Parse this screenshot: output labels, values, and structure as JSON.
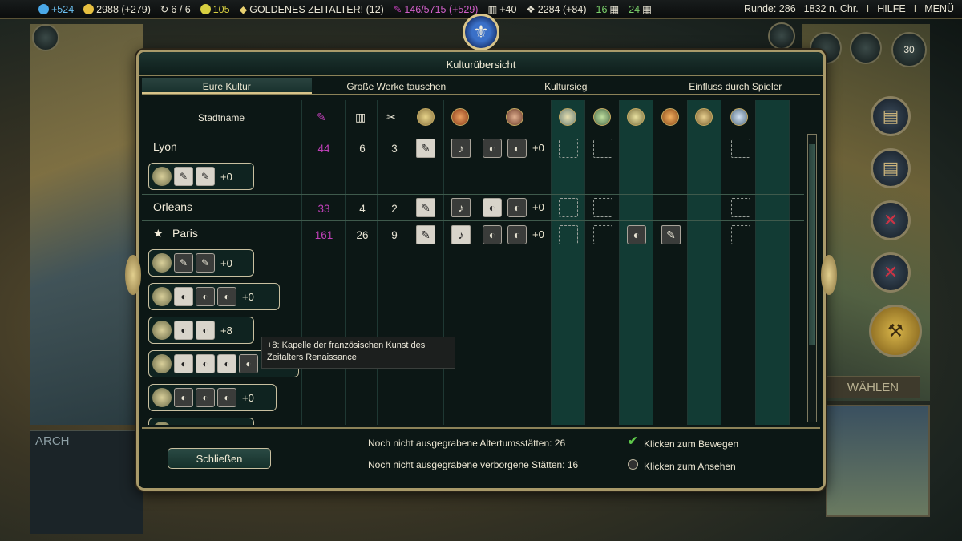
{
  "topbar": {
    "science": "+524",
    "gold": "2988 (+279)",
    "trade": "6 / 6",
    "happiness": "105",
    "golden_age": "GOLDENES ZEITALTER! (12)",
    "culture": "146/5715 (+529)",
    "tourism": "+40",
    "faith": "2284 (+84)",
    "res1": "16",
    "res2": "24",
    "turn": "Runde: 286",
    "year": "1832 n. Chr.",
    "help": "HILFE",
    "menu": "MENÜ",
    "colors": {
      "science": "#4aa8e8",
      "gold": "#e8c040",
      "culture": "#c040b8",
      "happy": "#d8d040"
    }
  },
  "dialog": {
    "title": "Kulturübersicht",
    "emblem": "fleur-de-lis-icon",
    "tabs": [
      {
        "label": "Eure Kultur",
        "active": true
      },
      {
        "label": "Große Werke tauschen",
        "active": false
      },
      {
        "label": "Kultursieg",
        "active": false
      },
      {
        "label": "Einfluss durch Spieler",
        "active": false
      }
    ],
    "header": {
      "city_name": "Stadtname"
    },
    "cities": [
      {
        "name": "Lyon",
        "culture": "44",
        "tourism": "6",
        "great_works": "3",
        "plus": "+0",
        "building_plus": "+0"
      },
      {
        "name": "Orleans",
        "culture": "33",
        "tourism": "4",
        "great_works": "2",
        "plus": "+0"
      },
      {
        "name": "Paris",
        "culture": "161",
        "tourism": "26",
        "great_works": "9",
        "plus": "+0",
        "buildings": [
          "+0",
          "+0",
          "+8",
          "",
          "+0"
        ]
      }
    ],
    "tooltip": {
      "line1": "+8: Kapelle der französischen Kunst des",
      "line2": "Zeitalters Renaissance"
    },
    "footer": {
      "close": "Schließen",
      "unexcavated": "Noch nicht ausgegrabene Altertumsstätten: 26",
      "hidden": "Noch nicht ausgegrabene verborgene Stätten: 16",
      "move": "Klicken zum Bewegen",
      "view": "Klicken zum Ansehen"
    }
  },
  "background": {
    "right_panel_label": "WÄHLEN",
    "left_panel_label": "ARCH",
    "unit_badge": "30"
  }
}
